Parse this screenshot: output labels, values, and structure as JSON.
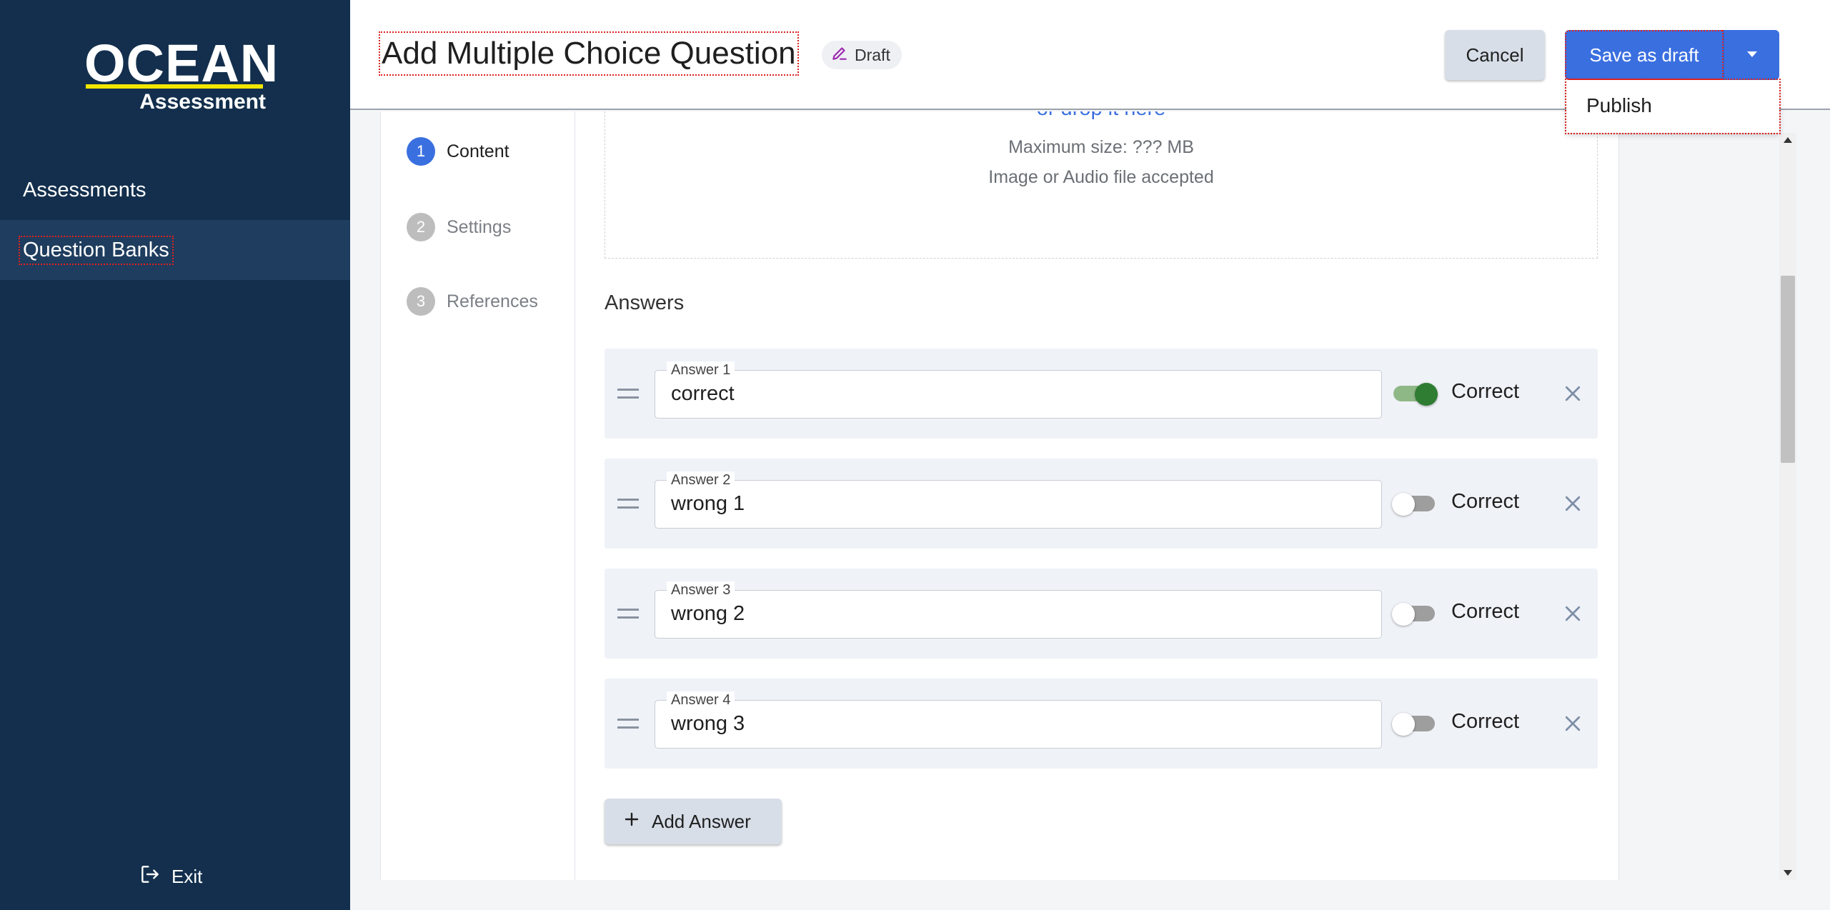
{
  "app": {
    "logo_word": "OCEAN",
    "logo_sub": "Assessment"
  },
  "sidebar": {
    "items": [
      {
        "label": "Assessments",
        "active": false
      },
      {
        "label": "Question Banks",
        "active": true
      }
    ],
    "exit_label": "Exit"
  },
  "header": {
    "title": "Add Multiple Choice Question",
    "status_chip": "Draft",
    "cancel_label": "Cancel",
    "save_label": "Save as draft",
    "dropdown_items": [
      "Publish"
    ]
  },
  "stepper": {
    "steps": [
      {
        "number": "1",
        "label": "Content",
        "active": true
      },
      {
        "number": "2",
        "label": "Settings",
        "active": false
      },
      {
        "number": "3",
        "label": "References",
        "active": false
      }
    ]
  },
  "upload": {
    "link_text": "or drop it here",
    "max_size": "Maximum size: ??? MB",
    "accepted": "Image or Audio file accepted"
  },
  "answers": {
    "heading": "Answers",
    "items": [
      {
        "label": "Answer 1",
        "value": "correct",
        "correct_label": "Correct",
        "is_correct": true
      },
      {
        "label": "Answer 2",
        "value": "wrong 1",
        "correct_label": "Correct",
        "is_correct": false
      },
      {
        "label": "Answer 3",
        "value": "wrong 2",
        "correct_label": "Correct",
        "is_correct": false
      },
      {
        "label": "Answer 4",
        "value": "wrong 3",
        "correct_label": "Correct",
        "is_correct": false
      }
    ],
    "add_label": "Add Answer"
  },
  "colors": {
    "sidebar_bg": "#132f4d",
    "accent": "#3a6fe0",
    "logo_underline": "#f2e600",
    "toggle_on": "#2e7d32"
  },
  "icons": {
    "draft_chip": "pencil-edit-icon",
    "exit": "exit-icon",
    "dropdown": "caret-down-icon",
    "drag": "drag-handle-icon",
    "remove": "close-icon",
    "add": "plus-icon"
  }
}
